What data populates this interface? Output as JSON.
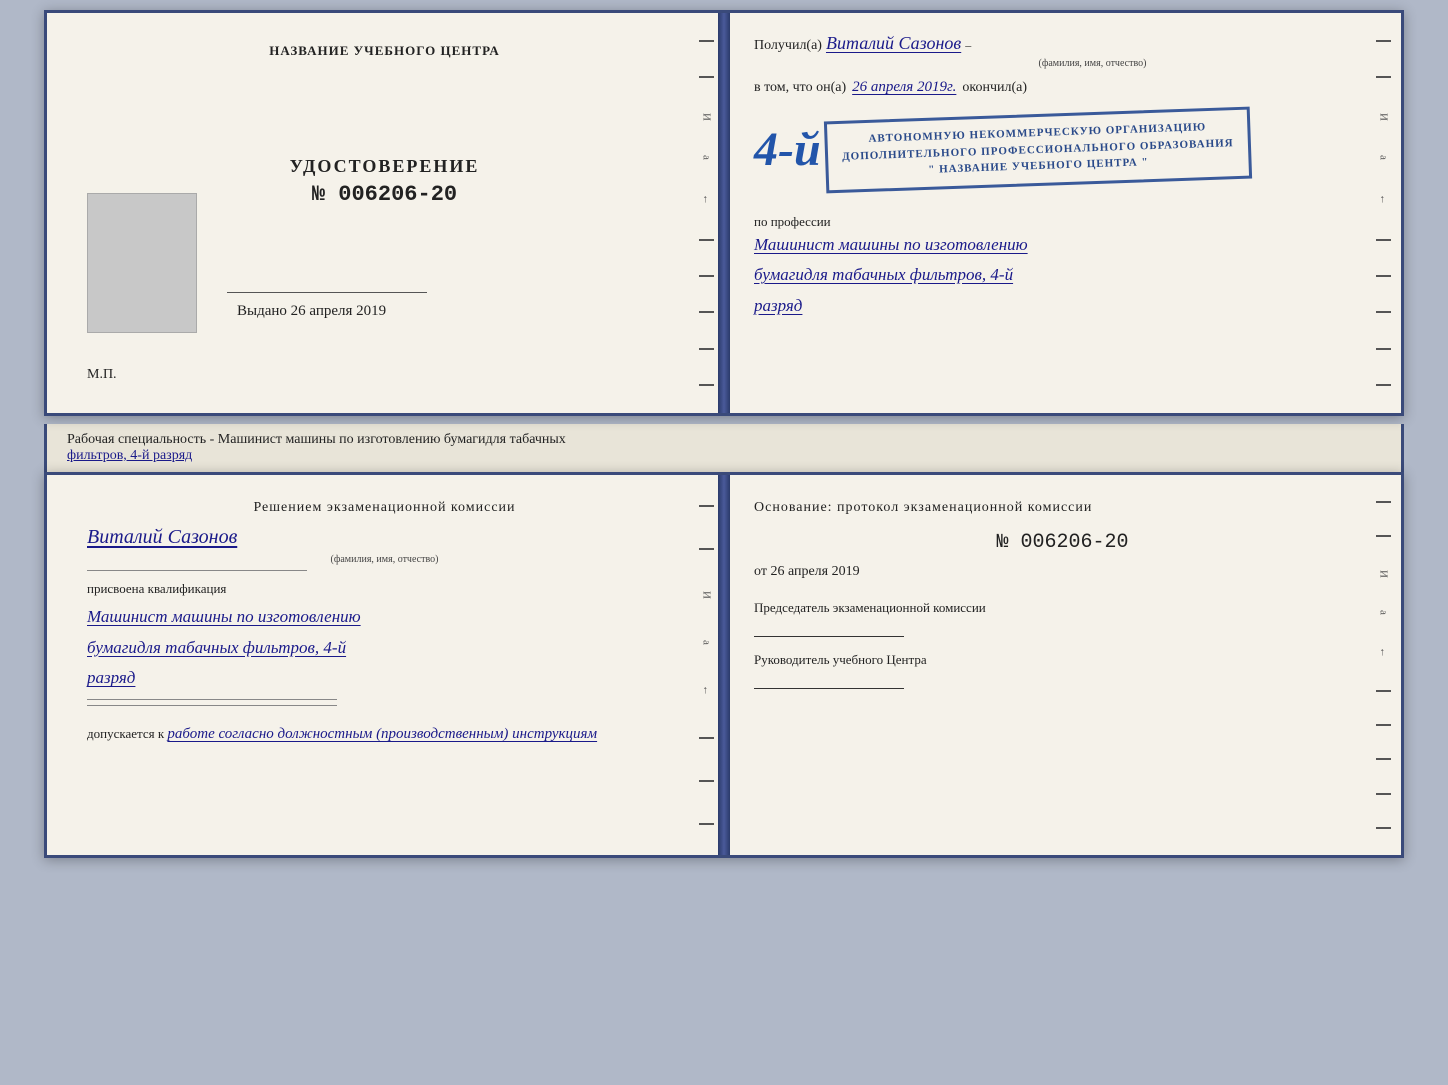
{
  "page": {
    "background_color": "#b0b8c8"
  },
  "top_book": {
    "left_page": {
      "header": "НАЗВАНИЕ УЧЕБНОГО ЦЕНТРА",
      "document_type": "УДОСТОВЕРЕНИЕ",
      "document_number_prefix": "№",
      "document_number": "006206-20",
      "vydano_prefix": "Выдано",
      "vydano_date": "26 апреля 2019",
      "mp_label": "М.П."
    },
    "right_page": {
      "poluchil_label": "Получил(а)",
      "recipient_name": "Виталий Сазонов",
      "recipient_fio_hint": "(фамилия, имя, отчество)",
      "vtom_chto_prefix": "в том, что он(а)",
      "vtom_date": "26 апреля 2019г.",
      "okonchil_label": "окончил(а)",
      "four_badge": "4-й",
      "stamp_line1": "АВТОНОМНУЮ НЕКОММЕРЧЕСКУЮ ОРГАНИЗАЦИЮ",
      "stamp_line2": "ДОПОЛНИТЕЛЬНОГО ПРОФЕССИОНАЛЬНОГО ОБРАЗОВАНИЯ",
      "stamp_line3": "\" НАЗВАНИЕ УЧЕБНОГО ЦЕНТРА \"",
      "po_professii": "по профессии",
      "profession_line1": "Машинист машины по изготовлению",
      "profession_line2": "бумагидля табачных фильтров, 4-й",
      "profession_line3": "разряд"
    }
  },
  "specialty_bar": {
    "prefix": "Рабочая специальность - Машинист машины по изготовлению бумагидля табачных",
    "underlined": "фильтров, 4-й разряд"
  },
  "bottom_book": {
    "left_page": {
      "resheniyem": "Решением экзаменационной комиссии",
      "name": "Виталий Сазонов",
      "fio_hint": "(фамилия, имя, отчество)",
      "prisvoyena": "присвоена квалификация",
      "qualification_line1": "Машинист машины по изготовлению",
      "qualification_line2": "бумагидля табачных фильтров, 4-й",
      "qualification_line3": "разряд",
      "dopuskaetsya_prefix": "допускается к",
      "dopuskaetsya_text": "работе согласно должностным (производственным) инструкциям"
    },
    "right_page": {
      "osnovanie": "Основание: протокол экзаменационной комиссии",
      "number_prefix": "№",
      "number": "006206-20",
      "ot_prefix": "от",
      "ot_date": "26 апреля 2019",
      "predsedatel_label": "Председатель экзаменационной комиссии",
      "rukovoditel_label": "Руководитель учебного Центра"
    }
  }
}
